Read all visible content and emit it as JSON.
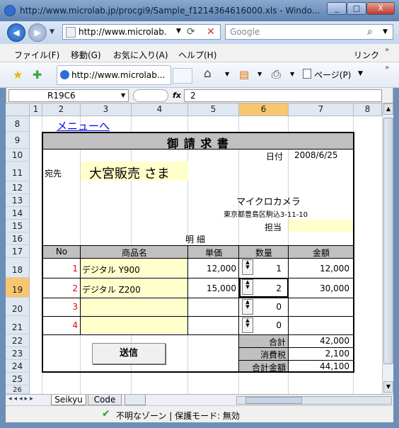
{
  "window": {
    "title": "http://www.microlab.jp/procgi9/Sample_f1214364616000.xls - Windo...",
    "min": "_",
    "max": "□",
    "close": "X"
  },
  "address": {
    "url": "http://www.microlab.",
    "refresh_icon": "⟳",
    "stop_icon": "✕"
  },
  "search": {
    "placeholder": "Google",
    "icon": "⌕"
  },
  "menus": [
    "ファイル(F)",
    "移動(G)",
    "お気に入り(A)",
    "ヘルプ(H)"
  ],
  "links_label": "リンク",
  "tab": {
    "label": "http://www.microlab..."
  },
  "toolbar": {
    "page_label": "ページ(P)",
    "home": "⌂",
    "feeds": "▤",
    "print": "⎙"
  },
  "excel": {
    "namebox": "R19C6",
    "fx": "fx",
    "formula": "2",
    "columns": [
      "1",
      "2",
      "3",
      "4",
      "5",
      "6",
      "7",
      "8"
    ],
    "rows": [
      "8",
      "9",
      "10",
      "11",
      "12",
      "13",
      "14",
      "15",
      "16",
      "17",
      "18",
      "19",
      "20",
      "21",
      "22",
      "23",
      "24",
      "25",
      "26"
    ],
    "menu_link": "メニューへ",
    "invoice_title": "御 請 求 書",
    "date_label": "日付",
    "date_value": "2008/6/25",
    "addressee_label": "宛先",
    "addressee": "大宮販売 さま",
    "company": "マイクロカメラ",
    "company_address": "東京都豊島区駒込3-11-10",
    "person_label": "担当",
    "details_label": "明 細",
    "headers": [
      "No",
      "商品名",
      "単価",
      "数量",
      "金額"
    ],
    "items": [
      {
        "no": "1",
        "name": "デジタル  Y900",
        "price": "12,000",
        "qty": "1",
        "amount": "12,000"
      },
      {
        "no": "2",
        "name": "デジタル  Z200",
        "price": "15,000",
        "qty": "2",
        "amount": "30,000"
      },
      {
        "no": "3",
        "name": "",
        "price": "",
        "qty": "0",
        "amount": ""
      },
      {
        "no": "4",
        "name": "",
        "price": "",
        "qty": "0",
        "amount": ""
      }
    ],
    "total_label": "合計",
    "total": "42,000",
    "tax_label": "消費税",
    "tax": "2,100",
    "grand_label": "合計金額",
    "grand": "44,100",
    "send_button": "送信",
    "sheet_tabs": [
      "Seikyu",
      "Code"
    ]
  },
  "status": {
    "text": "不明なゾーン | 保護モード: 無効"
  }
}
